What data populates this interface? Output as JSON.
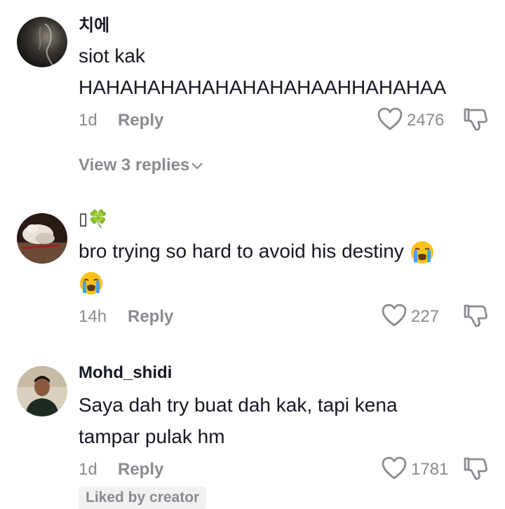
{
  "comments": [
    {
      "username": "치에",
      "lines": [
        "siot kak",
        "HAHAHAHAHAHAHAHAHAAHHAHAHAA"
      ],
      "time": "1d",
      "reply_label": "Reply",
      "likes": "2476",
      "view_replies": "View 3 replies",
      "avatar_icon": "avatar-dark-portrait"
    },
    {
      "username": "▯🍀",
      "lines": [
        "bro trying so hard to avoid his destiny"
      ],
      "emoji": "loudly-crying-face",
      "time": "14h",
      "reply_label": "Reply",
      "likes": "227",
      "avatar_icon": "avatar-pet-photo"
    },
    {
      "username": "Mohd_shidi",
      "lines": [
        "Saya dah try buat dah kak, tapi kena",
        "tampar pulak hm"
      ],
      "time": "1d",
      "reply_label": "Reply",
      "likes": "1781",
      "badge": "Liked by creator",
      "avatar_icon": "avatar-person-photo"
    }
  ],
  "colors": {
    "text": "#161823",
    "muted": "#8a8b91",
    "badge_bg": "#f1f1f2"
  }
}
